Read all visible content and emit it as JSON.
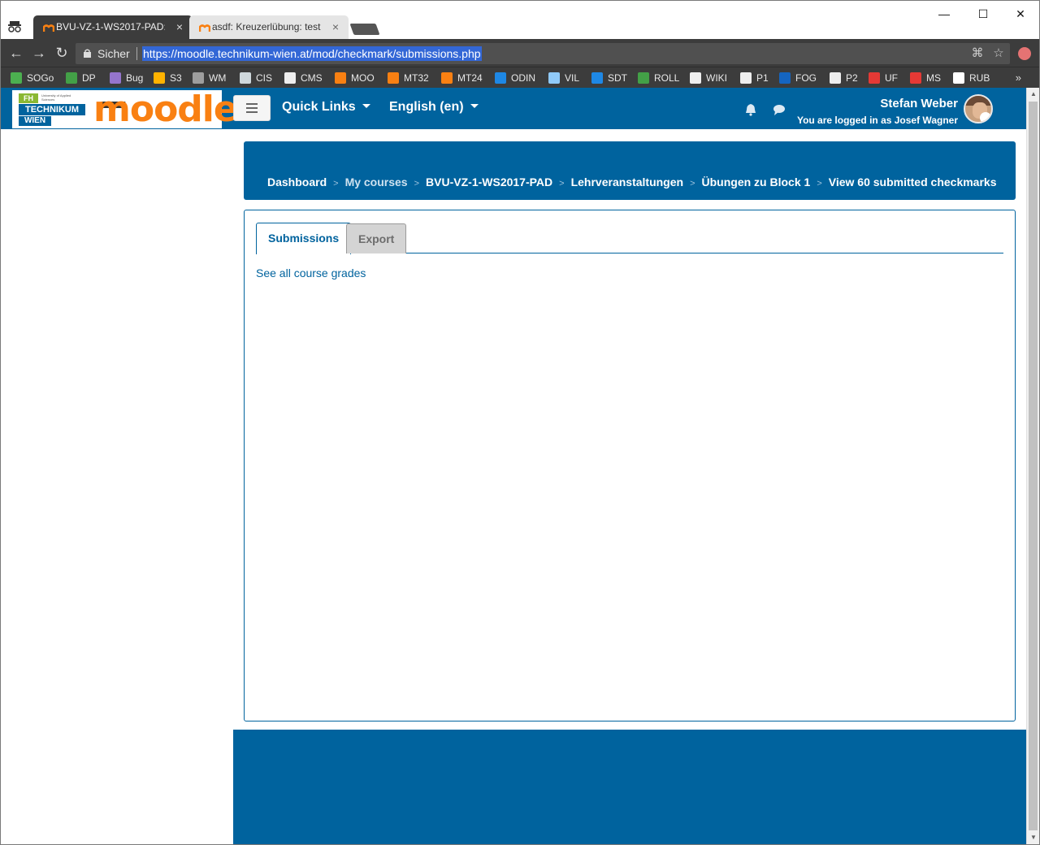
{
  "browser": {
    "tabs": [
      {
        "title": "BVU-VZ-1-WS2017-PAD:",
        "close": "×"
      },
      {
        "title": "asdf: Kreuzerlübung: test",
        "close": "×"
      }
    ],
    "window_controls": {
      "minimize": "—",
      "maximize": "☐",
      "close": "✕"
    },
    "nav": {
      "back": "←",
      "forward": "→",
      "reload": "↻"
    },
    "secure_label": "Sicher",
    "url": "https://moodle.technikum-wien.at/mod/checkmark/submissions.php",
    "bookmarks_more": "»",
    "bookmarks": [
      {
        "label": "SOGo",
        "color": "#4caf50"
      },
      {
        "label": "DP",
        "color": "#43a047"
      },
      {
        "label": "Bug",
        "color": "#9575cd"
      },
      {
        "label": "S3",
        "color": "#ffb300"
      },
      {
        "label": "WM",
        "color": "#9e9e9e"
      },
      {
        "label": "CIS",
        "color": "#cfd8dc"
      },
      {
        "label": "CMS",
        "color": "#eeeeee"
      },
      {
        "label": "MOO",
        "color": "#f98012"
      },
      {
        "label": "MT32",
        "color": "#f98012"
      },
      {
        "label": "MT24",
        "color": "#f98012"
      },
      {
        "label": "ODIN",
        "color": "#1e88e5"
      },
      {
        "label": "VIL",
        "color": "#90caf9"
      },
      {
        "label": "SDT",
        "color": "#1e88e5"
      },
      {
        "label": "ROLL",
        "color": "#43a047"
      },
      {
        "label": "WIKI",
        "color": "#eeeeee"
      },
      {
        "label": "P1",
        "color": "#eeeeee"
      },
      {
        "label": "FOG",
        "color": "#1565c0"
      },
      {
        "label": "P2",
        "color": "#eeeeee"
      },
      {
        "label": "UF",
        "color": "#e53935"
      },
      {
        "label": "MS",
        "color": "#e53935"
      },
      {
        "label": "RUB",
        "color": "#ffffff"
      }
    ]
  },
  "navbar": {
    "quick_links": "Quick Links",
    "language": "English (en)",
    "user_name": "Stefan Weber",
    "logged_in_as": "You are logged in as Josef Wagner"
  },
  "logo": {
    "fh": "FH",
    "fh_small": "University of Applied Sciences",
    "technikum": "TECHNIKUM",
    "wien": "WIEN",
    "moodle": "moodle"
  },
  "breadcrumb": [
    "Dashboard",
    "My courses",
    "BVU-VZ-1-WS2017-PAD",
    "Lehrveranstaltungen",
    "Übungen zu Block 1",
    "View 60 submitted checkmarks"
  ],
  "breadcrumb_sep": ">",
  "page_tabs": [
    {
      "label": "Submissions"
    },
    {
      "label": "Export"
    }
  ],
  "course_grades_link": "See all course grades",
  "colors": {
    "brand_blue": "#00639e",
    "moodle_orange": "#f98012"
  }
}
